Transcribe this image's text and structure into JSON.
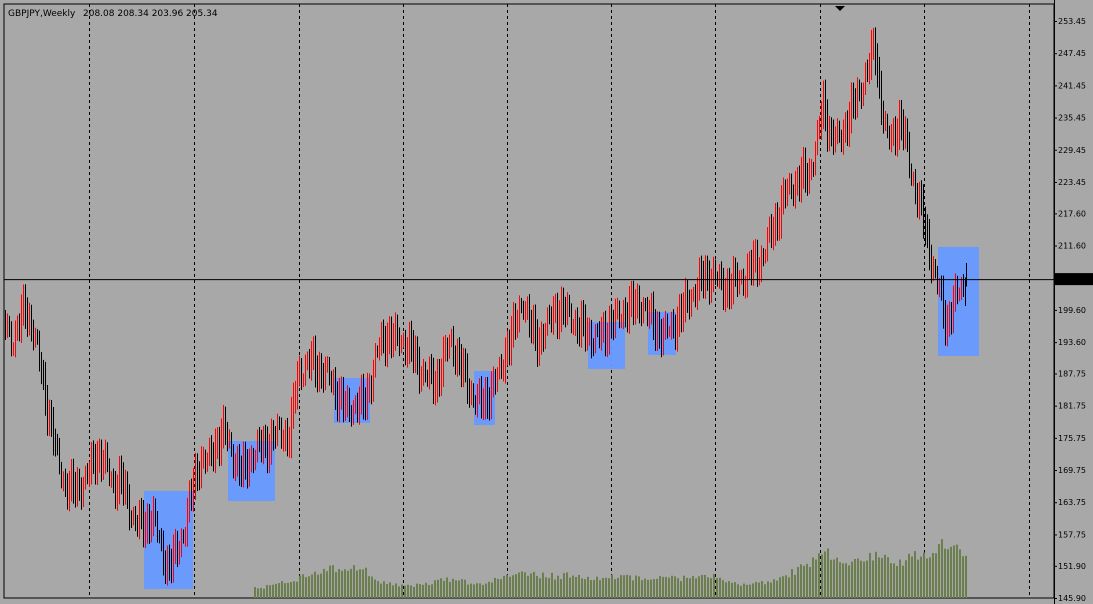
{
  "header": {
    "symbol_timeframe": "GBPJPY,Weekly",
    "ohlc": "208.08 208.34 203.96 205.34"
  },
  "colors": {
    "background": "#a8a8a8",
    "grid": "#000000",
    "bull_bar": "#ff0000",
    "bear_bar": "#000000",
    "highlight_box": "#6699ff",
    "volume": "#6b7f4e",
    "current_price_line": "#000000"
  },
  "chart_data": {
    "type": "bar",
    "subtype": "ohlc",
    "symbol": "GBPJPY",
    "timeframe": "Weekly",
    "current_price": 205.34,
    "last_bar": {
      "open": 208.08,
      "high": 208.34,
      "low": 203.96,
      "close": 205.34
    },
    "ylim": [
      145.9,
      255.0
    ],
    "y_ticks": [
      "253.45",
      "247.45",
      "241.45",
      "235.45",
      "229.45",
      "223.45",
      "217.60",
      "211.60",
      "205.34",
      "199.60",
      "193.60",
      "187.75",
      "181.75",
      "175.75",
      "169.75",
      "163.75",
      "157.75",
      "151.90",
      "145.90"
    ],
    "y_tick_values": [
      253.45,
      247.45,
      241.45,
      235.45,
      229.45,
      223.45,
      217.6,
      211.6,
      205.34,
      199.6,
      193.6,
      187.75,
      181.75,
      175.75,
      169.75,
      163.75,
      157.75,
      151.9,
      145.9
    ],
    "grid": "vertical dashed",
    "series": [
      {
        "name": "",
        "close_path": [
          [
            0,
            197
          ],
          [
            6,
            194
          ],
          [
            12,
            196
          ],
          [
            20,
            200
          ],
          [
            28,
            196
          ],
          [
            36,
            188
          ],
          [
            44,
            180
          ],
          [
            52,
            172
          ],
          [
            60,
            167
          ],
          [
            68,
            166
          ],
          [
            76,
            167
          ],
          [
            84,
            169
          ],
          [
            92,
            173
          ],
          [
            100,
            171
          ],
          [
            108,
            167
          ],
          [
            116,
            168
          ],
          [
            124,
            163
          ],
          [
            132,
            160
          ],
          [
            140,
            159
          ],
          [
            148,
            162
          ],
          [
            156,
            155
          ],
          [
            164,
            152
          ],
          [
            172,
            154
          ],
          [
            180,
            159
          ],
          [
            188,
            166
          ],
          [
            196,
            172
          ],
          [
            204,
            171
          ],
          [
            212,
            175
          ],
          [
            220,
            177
          ],
          [
            230,
            172
          ],
          [
            238,
            169
          ],
          [
            246,
            172
          ],
          [
            256,
            174
          ],
          [
            266,
            175
          ],
          [
            276,
            177
          ],
          [
            286,
            176
          ],
          [
            294,
            188
          ],
          [
            302,
            189
          ],
          [
            310,
            190
          ],
          [
            318,
            188
          ],
          [
            326,
            187
          ],
          [
            334,
            184
          ],
          [
            342,
            181
          ],
          [
            352,
            182
          ],
          [
            360,
            182
          ],
          [
            368,
            187
          ],
          [
            376,
            193
          ],
          [
            384,
            195
          ],
          [
            392,
            194
          ],
          [
            400,
            194
          ],
          [
            408,
            192
          ],
          [
            416,
            189
          ],
          [
            424,
            187
          ],
          [
            432,
            186
          ],
          [
            440,
            190
          ],
          [
            448,
            194
          ],
          [
            456,
            190
          ],
          [
            464,
            186
          ],
          [
            472,
            183
          ],
          [
            480,
            182
          ],
          [
            488,
            185
          ],
          [
            496,
            187
          ],
          [
            504,
            193
          ],
          [
            512,
            196
          ],
          [
            520,
            202
          ],
          [
            528,
            196
          ],
          [
            536,
            194
          ],
          [
            544,
            196
          ],
          [
            552,
            200
          ],
          [
            560,
            199
          ],
          [
            568,
            199
          ],
          [
            576,
            196
          ],
          [
            584,
            196
          ],
          [
            592,
            194
          ],
          [
            600,
            195
          ],
          [
            608,
            197
          ],
          [
            616,
            198
          ],
          [
            624,
            200
          ],
          [
            632,
            200
          ],
          [
            640,
            201
          ],
          [
            648,
            198
          ],
          [
            656,
            196
          ],
          [
            664,
            195
          ],
          [
            672,
            197
          ],
          [
            680,
            199
          ],
          [
            688,
            202
          ],
          [
            696,
            204
          ],
          [
            704,
            206
          ],
          [
            712,
            206
          ],
          [
            720,
            204
          ],
          [
            728,
            204
          ],
          [
            736,
            205
          ],
          [
            744,
            206
          ],
          [
            752,
            208
          ],
          [
            760,
            209
          ],
          [
            768,
            213
          ],
          [
            776,
            217
          ],
          [
            784,
            221
          ],
          [
            792,
            223
          ],
          [
            800,
            224
          ],
          [
            808,
            225
          ],
          [
            816,
            231
          ],
          [
            822,
            238
          ],
          [
            830,
            232
          ],
          [
            838,
            231
          ],
          [
            846,
            235
          ],
          [
            854,
            238
          ],
          [
            860,
            241
          ],
          [
            868,
            245
          ],
          [
            874,
            249
          ],
          [
            880,
            239
          ],
          [
            886,
            231
          ],
          [
            892,
            232
          ],
          [
            898,
            235
          ],
          [
            904,
            232
          ],
          [
            910,
            226
          ],
          [
            916,
            221
          ],
          [
            922,
            217
          ],
          [
            928,
            212
          ],
          [
            934,
            206
          ],
          [
            940,
            202
          ],
          [
            946,
            197
          ],
          [
            952,
            200
          ],
          [
            958,
            203
          ],
          [
            966,
            205.34
          ]
        ]
      }
    ],
    "highlight_zones": [
      {
        "x0": 60,
        "x1": 72,
        "y0": 147,
        "y1": 166
      },
      {
        "x0": 86,
        "x1": 99,
        "y0": 165,
        "y1": 174
      },
      {
        "x0": 128,
        "x1": 141,
        "y0": 183,
        "y1": 188
      },
      {
        "x0": 181,
        "x1": 189,
        "y0": 182,
        "y1": 185
      },
      {
        "x0": 226,
        "x1": 238,
        "y0": 191,
        "y1": 193
      },
      {
        "x0": 250,
        "x1": 260,
        "y0": 193,
        "y1": 195
      },
      {
        "x0": 337,
        "x1": 353,
        "y0": 190,
        "y1": 211
      }
    ],
    "volume": {
      "start_x": 254,
      "end_x": 966,
      "relative_profile": [
        0.12,
        0.14,
        0.18,
        0.2,
        0.25,
        0.3,
        0.34,
        0.38,
        0.36,
        0.4,
        0.34,
        0.22,
        0.18,
        0.16,
        0.15,
        0.17,
        0.2,
        0.24,
        0.22,
        0.2,
        0.18,
        0.2,
        0.24,
        0.28,
        0.3,
        0.29,
        0.28,
        0.27,
        0.28,
        0.26,
        0.25,
        0.24,
        0.26,
        0.25,
        0.26,
        0.25,
        0.24,
        0.25,
        0.24,
        0.26,
        0.27,
        0.28,
        0.22,
        0.18,
        0.16,
        0.18,
        0.2,
        0.24,
        0.3,
        0.36,
        0.46,
        0.62,
        0.48,
        0.4,
        0.44,
        0.48,
        0.52,
        0.46,
        0.42,
        0.5,
        0.54,
        0.58,
        0.66,
        0.6,
        0.5
      ]
    }
  }
}
